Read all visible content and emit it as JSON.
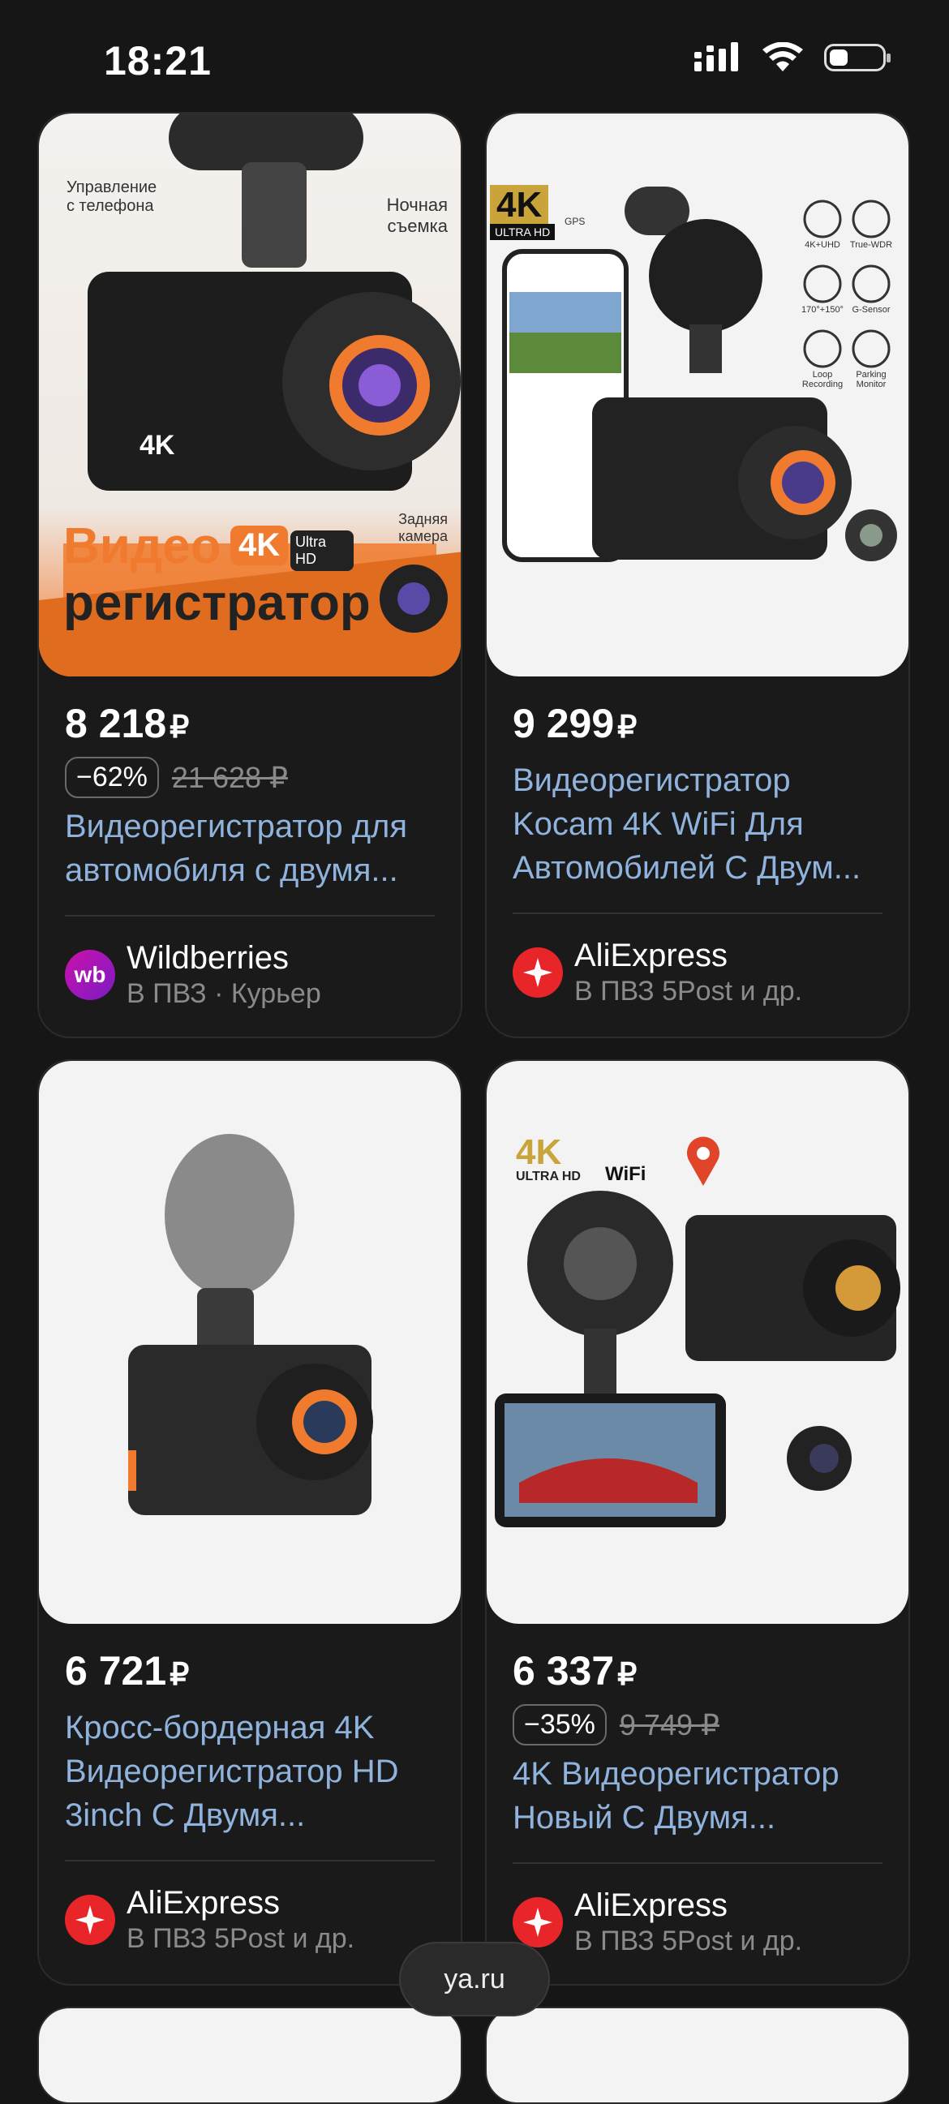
{
  "status": {
    "time": "18:21"
  },
  "products": [
    {
      "image_text": {
        "top_left": "Управление\nс телефона",
        "night": "Ночная\nсъемка",
        "badge": "4K",
        "badge2": "Ultra HD",
        "rear": "Задняя\nкамера",
        "headline1": "Видео",
        "headline2": "регистратор",
        "screen_mark": "4K"
      },
      "price": "8 218",
      "currency": "₽",
      "discount": "−62%",
      "old_price": "21 628 ₽",
      "title": "Видеорегистратор для автомобиля с двумя...",
      "seller": "Wildberries",
      "seller_logo_text": "wb",
      "delivery": "В ПВЗ · Курьер"
    },
    {
      "image_text": {
        "badge": "4K",
        "badge_sub": "ULTRA HD",
        "gps": "GPS",
        "features": [
          "4K+UHD",
          "True-WDR",
          "170°+150°",
          "G-Sensor",
          "Loop Recording",
          "Parking Monitor"
        ]
      },
      "price": "9 299",
      "currency": "₽",
      "title": "Видеорегистратор Kocam 4K WiFi Для Автомобилей С Двум...",
      "seller": "AliExpress",
      "delivery": "В ПВЗ 5Post и др."
    },
    {
      "price": "6 721",
      "currency": "₽",
      "title": "Кросс-бордерная 4K Видеорегистратор HD 3inch С Двумя...",
      "seller": "AliExpress",
      "delivery": "В ПВЗ 5Post и др."
    },
    {
      "image_text": {
        "k4": "4K",
        "ultra": "ULTRA HD",
        "wifi": "WiFi"
      },
      "price": "6 337",
      "currency": "₽",
      "discount": "−35%",
      "old_price": "9 749 ₽",
      "title": "4K Видеорегистратор Новый С Двумя...",
      "seller": "AliExpress",
      "delivery": "В ПВЗ 5Post и др."
    }
  ],
  "url_bar": {
    "text": "ya.ru"
  },
  "colors": {
    "background": "#161616",
    "link": "#8fb3dd",
    "accent_orange": "#f07b2e",
    "ali_red": "#e8262a"
  }
}
